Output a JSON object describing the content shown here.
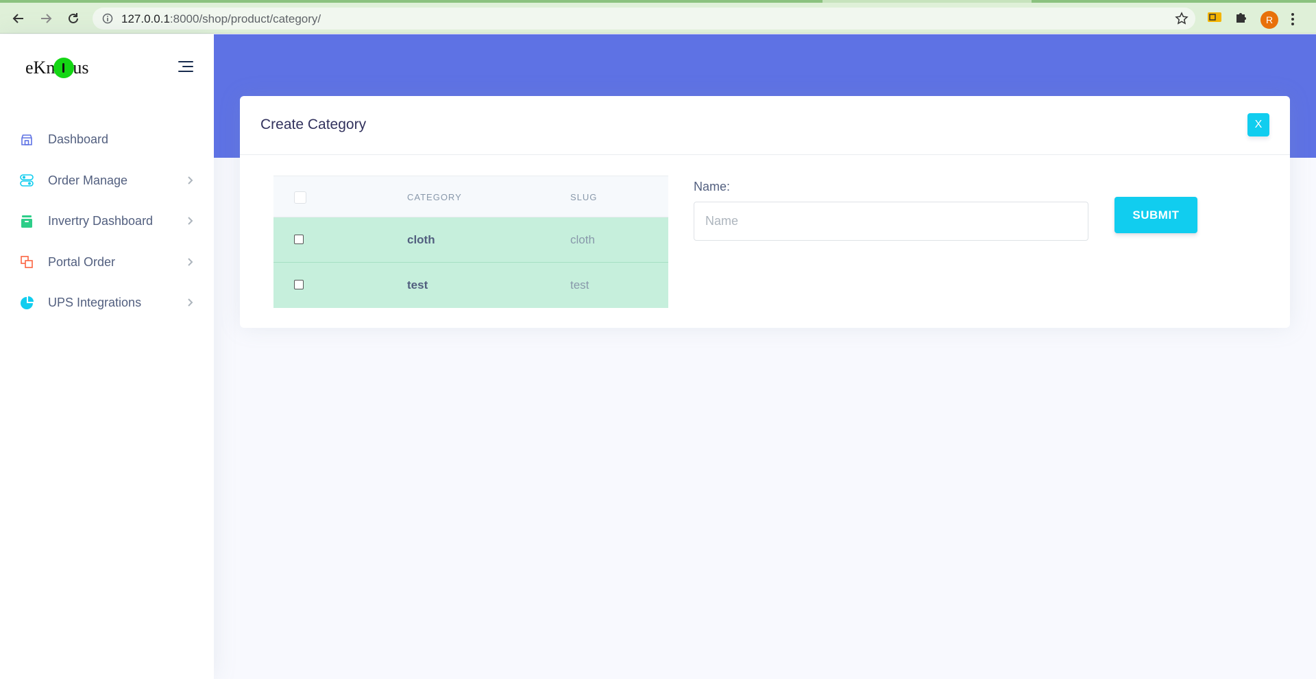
{
  "browser": {
    "url_host": "127.0.0.1",
    "url_rest": ":8000/shop/product/category/",
    "profile_initial": "R"
  },
  "sidebar": {
    "logo": {
      "left": "eKn",
      "right": "us"
    },
    "items": [
      {
        "label": "Dashboard",
        "icon": "shop-icon",
        "color": "#5e72e4",
        "has_children": false
      },
      {
        "label": "Order Manage",
        "icon": "toggles-icon",
        "color": "#11cdef",
        "has_children": true
      },
      {
        "label": "Invertry Dashboard",
        "icon": "archive-icon",
        "color": "#2dce89",
        "has_children": true
      },
      {
        "label": "Portal Order",
        "icon": "layers-icon",
        "color": "#fb6340",
        "has_children": true
      },
      {
        "label": "UPS Integrations",
        "icon": "pie-chart-icon",
        "color": "#11cdef",
        "has_children": true
      }
    ]
  },
  "card": {
    "title": "Create Category",
    "close_label": "X"
  },
  "table": {
    "columns": [
      "CATEGORY",
      "SLUG"
    ],
    "rows": [
      {
        "category": "cloth",
        "slug": "cloth"
      },
      {
        "category": "test",
        "slug": "test"
      }
    ]
  },
  "form": {
    "name_label": "Name:",
    "name_placeholder": "Name",
    "submit_label": "SUBMIT"
  },
  "colors": {
    "primary": "#5e72e4",
    "info": "#11cdef",
    "row_highlight": "#c6efdc"
  }
}
